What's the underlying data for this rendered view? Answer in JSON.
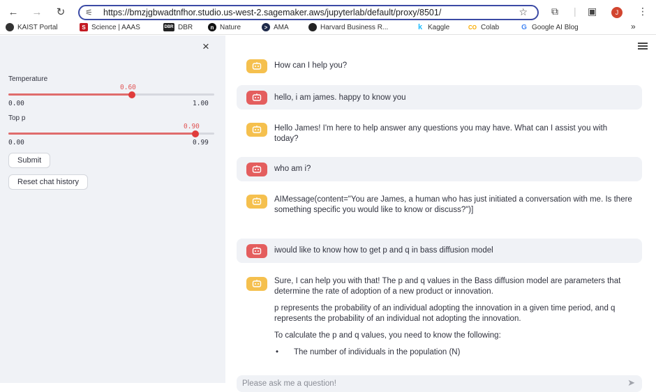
{
  "browser": {
    "url": "https://bmzjgbwadtnfhor.studio.us-west-2.sagemaker.aws/jupyterlab/default/proxy/8501/",
    "profile_initial": "J",
    "bookmarks": [
      {
        "label": "KAIST Portal",
        "icon": "K"
      },
      {
        "label": "Science | AAAS",
        "icon": "S"
      },
      {
        "label": "DBR",
        "icon": "DBR"
      },
      {
        "label": "Nature",
        "icon": "n"
      },
      {
        "label": "AMA",
        "icon": ">"
      },
      {
        "label": "Harvard Business R...",
        "icon": "H"
      },
      {
        "label": "Kaggle",
        "icon": "k"
      },
      {
        "label": "Colab",
        "icon": "CO"
      },
      {
        "label": "Google AI Blog",
        "icon": "G"
      }
    ],
    "more_bookmarks": "»"
  },
  "sidebar": {
    "close_icon": "×",
    "temperature": {
      "label": "Temperature",
      "value": "0.60",
      "min": "0.00",
      "max": "1.00",
      "fraction": 0.6
    },
    "top_p": {
      "label": "Top p",
      "value": "0.90",
      "min": "0.00",
      "max": "0.99",
      "fraction": 0.909
    },
    "submit_label": "Submit",
    "reset_label": "Reset chat history"
  },
  "chat": {
    "messages": [
      {
        "role": "assistant",
        "paragraphs": [
          "How can I help you?"
        ]
      },
      {
        "role": "user",
        "paragraphs": [
          "hello, i am james. happy to know you"
        ]
      },
      {
        "role": "assistant",
        "paragraphs": [
          "Hello James! I'm here to help answer any questions you may have. What can I assist you with today?"
        ]
      },
      {
        "role": "user",
        "paragraphs": [
          "who am i?"
        ]
      },
      {
        "role": "assistant",
        "paragraphs": [
          "AIMessage(content=\"You are James, a human who has just initiated a conversation with me. Is there something specific you would like to know or discuss?\")]"
        ]
      },
      {
        "role": "user",
        "paragraphs": [
          "iwould like to know how to get p and q in bass diffusion model"
        ]
      },
      {
        "role": "assistant",
        "paragraphs": [
          "Sure, I can help you with that! The p and q values in the Bass diffusion model are parameters that determine the rate of adoption of a new product or innovation.",
          "p represents the probability of an individual adopting the innovation in a given time period, and q represents the probability of an individual not adopting the innovation.",
          "To calculate the p and q values, you need to know the following:"
        ],
        "bullets": [
          "The number of individuals in the population (N)"
        ]
      }
    ],
    "input_placeholder": "Please ask me a question!"
  },
  "colors": {
    "accent": "#e03c3c",
    "bot_avatar": "#f5c04e",
    "user_avatar": "#e45e5e",
    "sidebar_bg": "#f0f2f6"
  }
}
